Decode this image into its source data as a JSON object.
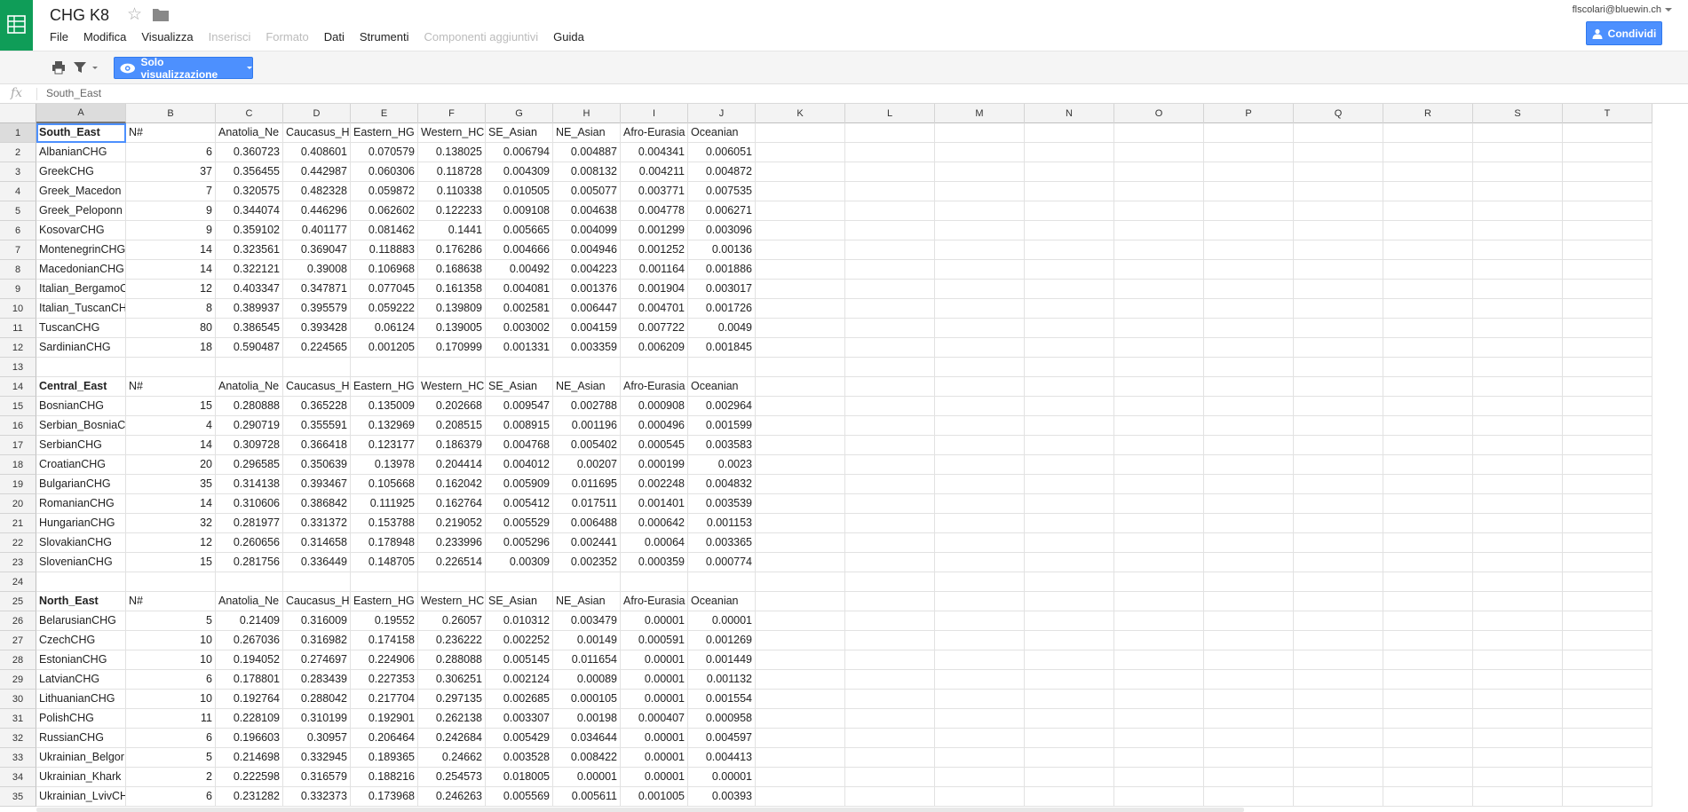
{
  "header": {
    "doc_title": "CHG K8",
    "user_email": "flscolari@bluewin.ch",
    "share_label": "Condividi",
    "menu": [
      {
        "label": "File",
        "disabled": false
      },
      {
        "label": "Modifica",
        "disabled": false
      },
      {
        "label": "Visualizza",
        "disabled": false
      },
      {
        "label": "Inserisci",
        "disabled": true
      },
      {
        "label": "Formato",
        "disabled": true
      },
      {
        "label": "Dati",
        "disabled": false
      },
      {
        "label": "Strumenti",
        "disabled": false
      },
      {
        "label": "Componenti aggiuntivi",
        "disabled": true
      },
      {
        "label": "Guida",
        "disabled": false
      }
    ]
  },
  "toolbar": {
    "view_only_label": "Solo visualizzazione"
  },
  "formula_bar": {
    "fx_label": "fx",
    "value": "South_East"
  },
  "sheet": {
    "columns": [
      "A",
      "B",
      "C",
      "D",
      "E",
      "F",
      "G",
      "H",
      "I",
      "J",
      "K",
      "L",
      "M",
      "N",
      "O",
      "P",
      "Q",
      "R",
      "S",
      "T"
    ],
    "active_column": "A",
    "active_row": 1,
    "rows": [
      [
        "South_East",
        "N#",
        "Anatolia_Ne",
        "Caucasus_H",
        "Eastern_HG",
        "Western_HC",
        "SE_Asian",
        "NE_Asian",
        "Afro-Eurasia",
        "Oceanian"
      ],
      [
        "AlbanianCHG",
        "6",
        "0.360723",
        "0.408601",
        "0.070579",
        "0.138025",
        "0.006794",
        "0.004887",
        "0.004341",
        "0.006051"
      ],
      [
        "GreekCHG",
        "37",
        "0.356455",
        "0.442987",
        "0.060306",
        "0.118728",
        "0.004309",
        "0.008132",
        "0.004211",
        "0.004872"
      ],
      [
        "Greek_Macedon",
        "7",
        "0.320575",
        "0.482328",
        "0.059872",
        "0.110338",
        "0.010505",
        "0.005077",
        "0.003771",
        "0.007535"
      ],
      [
        "Greek_Peloponn",
        "9",
        "0.344074",
        "0.446296",
        "0.062602",
        "0.122233",
        "0.009108",
        "0.004638",
        "0.004778",
        "0.006271"
      ],
      [
        "KosovarCHG",
        "9",
        "0.359102",
        "0.401177",
        "0.081462",
        "0.1441",
        "0.005665",
        "0.004099",
        "0.001299",
        "0.003096"
      ],
      [
        "MontenegrinCHG",
        "14",
        "0.323561",
        "0.369047",
        "0.118883",
        "0.176286",
        "0.004666",
        "0.004946",
        "0.001252",
        "0.00136"
      ],
      [
        "MacedonianCHG",
        "14",
        "0.322121",
        "0.39008",
        "0.106968",
        "0.168638",
        "0.00492",
        "0.004223",
        "0.001164",
        "0.001886"
      ],
      [
        "Italian_BergamoC",
        "12",
        "0.403347",
        "0.347871",
        "0.077045",
        "0.161358",
        "0.004081",
        "0.001376",
        "0.001904",
        "0.003017"
      ],
      [
        "Italian_TuscanCH",
        "8",
        "0.389937",
        "0.395579",
        "0.059222",
        "0.139809",
        "0.002581",
        "0.006447",
        "0.004701",
        "0.001726"
      ],
      [
        "TuscanCHG",
        "80",
        "0.386545",
        "0.393428",
        "0.06124",
        "0.139005",
        "0.003002",
        "0.004159",
        "0.007722",
        "0.0049"
      ],
      [
        "SardinianCHG",
        "18",
        "0.590487",
        "0.224565",
        "0.001205",
        "0.170999",
        "0.001331",
        "0.003359",
        "0.006209",
        "0.001845"
      ],
      [
        "",
        "",
        "",
        "",
        "",
        "",
        "",
        "",
        "",
        ""
      ],
      [
        "Central_East",
        "N#",
        "Anatolia_Ne",
        "Caucasus_H",
        "Eastern_HG",
        "Western_HC",
        "SE_Asian",
        "NE_Asian",
        "Afro-Eurasia",
        "Oceanian"
      ],
      [
        "BosnianCHG",
        "15",
        "0.280888",
        "0.365228",
        "0.135009",
        "0.202668",
        "0.009547",
        "0.002788",
        "0.000908",
        "0.002964"
      ],
      [
        "Serbian_BosniaC",
        "4",
        "0.290719",
        "0.355591",
        "0.132969",
        "0.208515",
        "0.008915",
        "0.001196",
        "0.000496",
        "0.001599"
      ],
      [
        "SerbianCHG",
        "14",
        "0.309728",
        "0.366418",
        "0.123177",
        "0.186379",
        "0.004768",
        "0.005402",
        "0.000545",
        "0.003583"
      ],
      [
        "CroatianCHG",
        "20",
        "0.296585",
        "0.350639",
        "0.13978",
        "0.204414",
        "0.004012",
        "0.00207",
        "0.000199",
        "0.0023"
      ],
      [
        "BulgarianCHG",
        "35",
        "0.314138",
        "0.393467",
        "0.105668",
        "0.162042",
        "0.005909",
        "0.011695",
        "0.002248",
        "0.004832"
      ],
      [
        "RomanianCHG",
        "14",
        "0.310606",
        "0.386842",
        "0.111925",
        "0.162764",
        "0.005412",
        "0.017511",
        "0.001401",
        "0.003539"
      ],
      [
        "HungarianCHG",
        "32",
        "0.281977",
        "0.331372",
        "0.153788",
        "0.219052",
        "0.005529",
        "0.006488",
        "0.000642",
        "0.001153"
      ],
      [
        "SlovakianCHG",
        "12",
        "0.260656",
        "0.314658",
        "0.178948",
        "0.233996",
        "0.005296",
        "0.002441",
        "0.00064",
        "0.003365"
      ],
      [
        "SlovenianCHG",
        "15",
        "0.281756",
        "0.336449",
        "0.148705",
        "0.226514",
        "0.00309",
        "0.002352",
        "0.000359",
        "0.000774"
      ],
      [
        "",
        "",
        "",
        "",
        "",
        "",
        "",
        "",
        "",
        ""
      ],
      [
        "North_East",
        "N#",
        "Anatolia_Ne",
        "Caucasus_H",
        "Eastern_HG",
        "Western_HC",
        "SE_Asian",
        "NE_Asian",
        "Afro-Eurasia",
        "Oceanian"
      ],
      [
        "BelarusianCHG",
        "5",
        "0.21409",
        "0.316009",
        "0.19552",
        "0.26057",
        "0.010312",
        "0.003479",
        "0.00001",
        "0.00001"
      ],
      [
        "CzechCHG",
        "10",
        "0.267036",
        "0.316982",
        "0.174158",
        "0.236222",
        "0.002252",
        "0.00149",
        "0.000591",
        "0.001269"
      ],
      [
        "EstonianCHG",
        "10",
        "0.194052",
        "0.274697",
        "0.224906",
        "0.288088",
        "0.005145",
        "0.011654",
        "0.00001",
        "0.001449"
      ],
      [
        "LatvianCHG",
        "6",
        "0.178801",
        "0.283439",
        "0.227353",
        "0.306251",
        "0.002124",
        "0.00089",
        "0.00001",
        "0.001132"
      ],
      [
        "LithuanianCHG",
        "10",
        "0.192764",
        "0.288042",
        "0.217704",
        "0.297135",
        "0.002685",
        "0.000105",
        "0.00001",
        "0.001554"
      ],
      [
        "PolishCHG",
        "11",
        "0.228109",
        "0.310199",
        "0.192901",
        "0.262138",
        "0.003307",
        "0.00198",
        "0.000407",
        "0.000958"
      ],
      [
        "RussianCHG",
        "6",
        "0.196603",
        "0.30957",
        "0.206464",
        "0.242684",
        "0.005429",
        "0.034644",
        "0.00001",
        "0.004597"
      ],
      [
        "Ukrainian_Belgor",
        "5",
        "0.214698",
        "0.332945",
        "0.189365",
        "0.24662",
        "0.003528",
        "0.008422",
        "0.00001",
        "0.004413"
      ],
      [
        "Ukrainian_Khark",
        "2",
        "0.222598",
        "0.316579",
        "0.188216",
        "0.254573",
        "0.018005",
        "0.00001",
        "0.00001",
        "0.00001"
      ],
      [
        "Ukrainian_LvivCH",
        "6",
        "0.231282",
        "0.332373",
        "0.173968",
        "0.246263",
        "0.005569",
        "0.005611",
        "0.001005",
        "0.00393"
      ]
    ]
  }
}
